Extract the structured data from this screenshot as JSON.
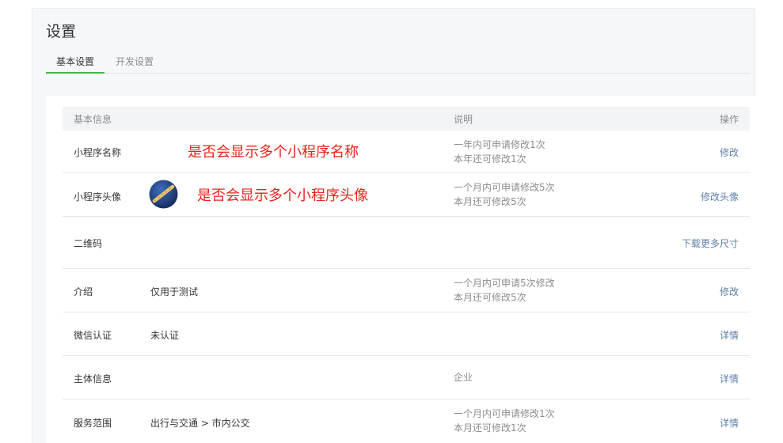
{
  "page": {
    "title": "设置"
  },
  "tabs": [
    {
      "label": "基本设置",
      "active": true
    },
    {
      "label": "开发设置",
      "active": false
    }
  ],
  "table": {
    "headers": {
      "info": "基本信息",
      "desc": "说明",
      "op": "操作"
    },
    "rows": [
      {
        "label": "小程序名称",
        "value": "",
        "desc_lines": [
          "一年内可申请修改1次",
          "本年还可修改1次"
        ],
        "action": "修改",
        "annotation": "是否会显示多个小程序名称"
      },
      {
        "label": "小程序头像",
        "value": "",
        "desc_lines": [
          "一个月内可申请修改5次",
          "本月还可修改5次"
        ],
        "action": "修改头像",
        "annotation": "是否会显示多个小程序头像",
        "avatar_icon": "flute-avatar-icon"
      },
      {
        "label": "二维码",
        "value": "",
        "desc_lines": [],
        "action": "下载更多尺寸"
      },
      {
        "label": "介绍",
        "value": "仅用于测试",
        "desc_lines": [
          "一个月内可申请5次修改",
          "本月还可修改5次"
        ],
        "action": "修改"
      },
      {
        "label": "微信认证",
        "value": "未认证",
        "desc_lines": [],
        "action": "详情"
      },
      {
        "label": "主体信息",
        "value": "",
        "desc_lines": [
          "企业"
        ],
        "action": "详情"
      },
      {
        "label": "服务范围",
        "value": "出行与交通 > 市内公交",
        "desc_lines": [
          "一个月内可申请修改1次",
          "本月还可修改1次"
        ],
        "action": "详情"
      }
    ]
  },
  "colors": {
    "accent": "#44b549",
    "link": "#607fa6",
    "annotation": "#e8231a",
    "muted": "#8d8d8d",
    "panel_bg": "#f6f7f9"
  }
}
